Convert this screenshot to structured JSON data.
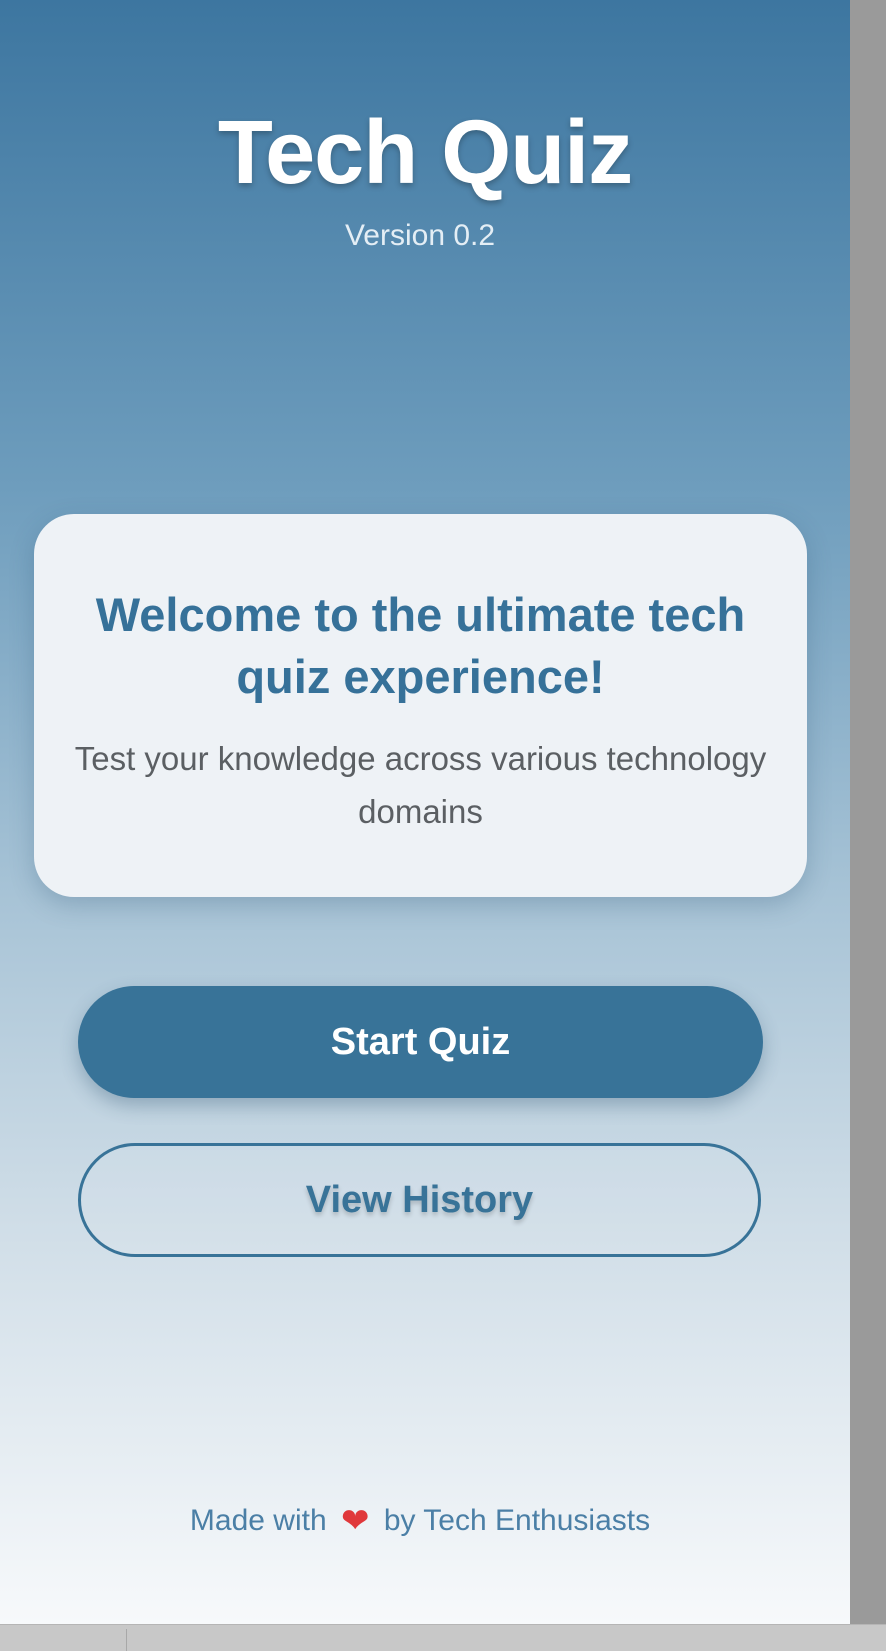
{
  "app": {
    "title": "Tech Quiz",
    "version": "Version 0.2"
  },
  "welcome_card": {
    "heading": "Welcome to the ultimate tech quiz experience!",
    "subtitle": "Test your knowledge across various technology domains"
  },
  "buttons": {
    "start_label": "Start Quiz",
    "history_label": "View History"
  },
  "footer": {
    "prefix": "Made with",
    "heart_icon": "heart-icon",
    "heart_glyph": "❤",
    "suffix": "by Tech Enthusiasts"
  },
  "colors": {
    "primary": "#387398",
    "heart": "#e0383b",
    "card_bg": "#eef2f6"
  }
}
